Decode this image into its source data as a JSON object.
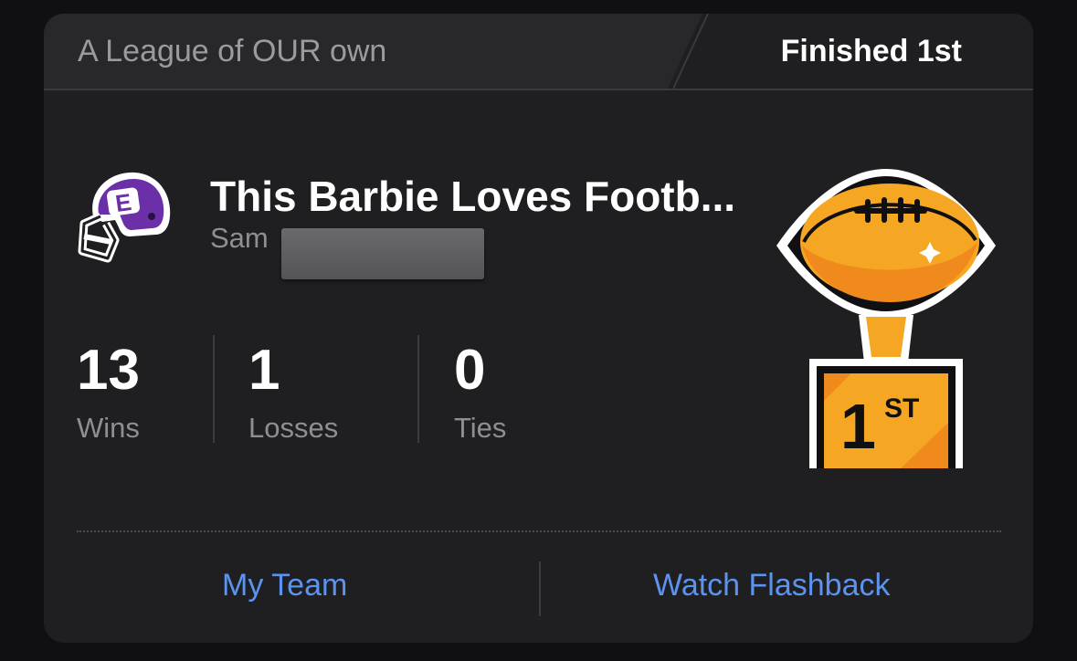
{
  "header": {
    "league_name": "A League of OUR own",
    "finish": "Finished 1st"
  },
  "team": {
    "name": "This Barbie Loves Footb...",
    "owner": "Sam",
    "helmet_logo_letter": "E",
    "helmet_icon": "football-helmet-icon",
    "helmet_color": "#6b2fa8"
  },
  "record": [
    {
      "value": "13",
      "label": "Wins"
    },
    {
      "value": "1",
      "label": "Losses"
    },
    {
      "value": "0",
      "label": "Ties"
    }
  ],
  "trophy": {
    "icon": "trophy-icon",
    "place": "1",
    "suffix": "ST",
    "color": "#f5a623"
  },
  "actions": {
    "my_team": "My Team",
    "watch_flashback": "Watch Flashback"
  },
  "colors": {
    "background": "#101012",
    "card": "#1f1f21",
    "header": "#28282b",
    "link": "#5b93ee"
  }
}
